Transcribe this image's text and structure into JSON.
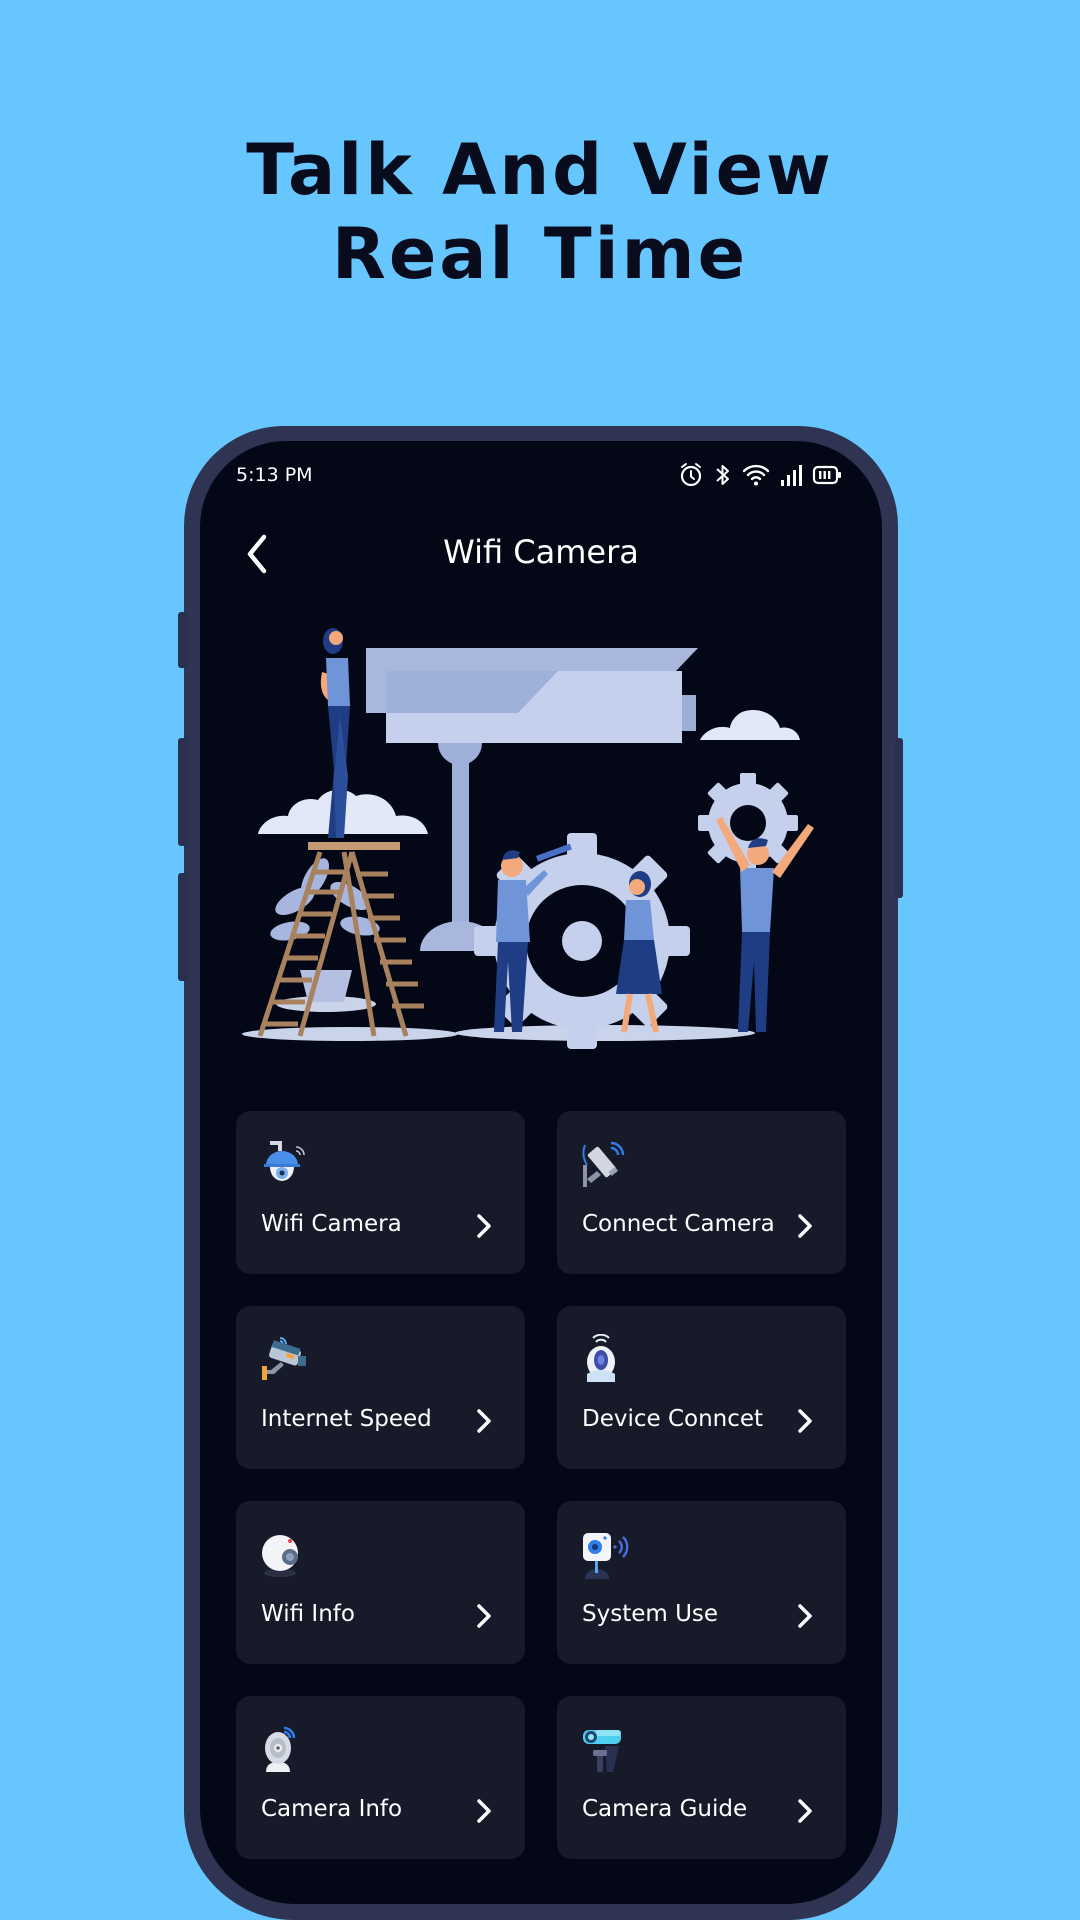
{
  "headline": {
    "line1": "Talk And View",
    "line2": "Real Time"
  },
  "status_bar": {
    "time": "5:13 PM",
    "icons": [
      "alarm-icon",
      "bluetooth-icon",
      "wifi-icon",
      "signal-icon",
      "battery-icon"
    ]
  },
  "header": {
    "title": "Wifi Camera",
    "back_icon": "chevron-left-icon"
  },
  "hero": {
    "description": "Illustration of people around a large security camera, gears, ladder and plant"
  },
  "menu": {
    "items": [
      {
        "label": "Wifi Camera",
        "icon": "dome-camera-icon"
      },
      {
        "label": "Connect Camera",
        "icon": "cctv-camera-icon"
      },
      {
        "label": "Internet Speed",
        "icon": "bullet-camera-icon"
      },
      {
        "label": "Device Conncet",
        "icon": "webcam-icon"
      },
      {
        "label": "Wifi Info",
        "icon": "spherical-camera-icon"
      },
      {
        "label": "System Use",
        "icon": "smart-camera-icon"
      },
      {
        "label": "Camera Info",
        "icon": "ip-camera-icon"
      },
      {
        "label": "Camera Guide",
        "icon": "mounted-camera-icon"
      }
    ]
  },
  "colors": {
    "page_bg": "#67c6fe",
    "headline": "#080c1d",
    "phone_frame": "#2f3453",
    "screen_bg": "#030716",
    "card_bg": "#171b29",
    "text": "#ffffff"
  }
}
